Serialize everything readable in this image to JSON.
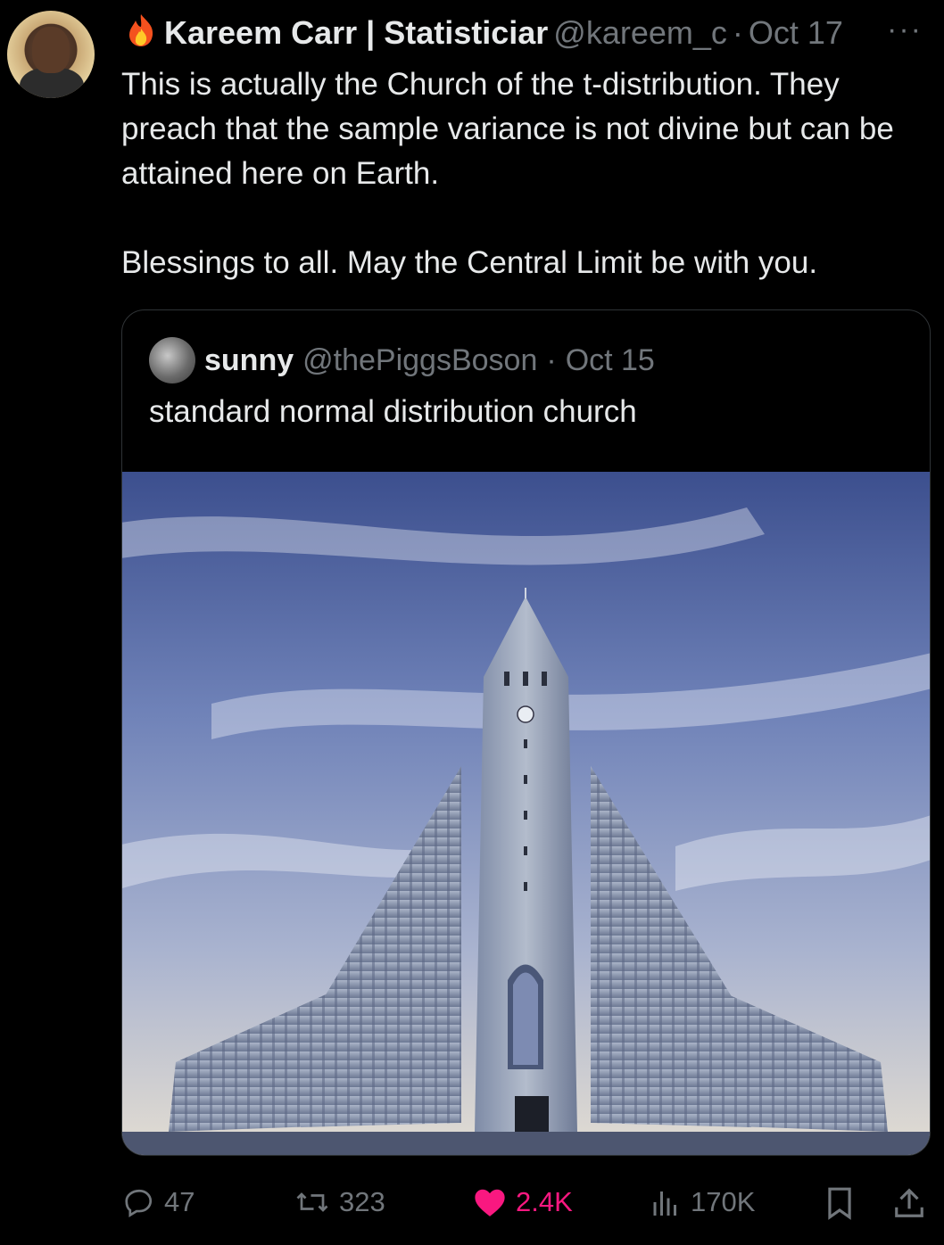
{
  "tweet": {
    "author_name": "Kareem Carr | Statisticiar",
    "handle": "@kareem_c",
    "separator": "·",
    "date": "Oct 17",
    "more": "···",
    "paragraph1": "This is actually the Church of the t-distribution. They preach that the sample variance is not divine but can be attained here on Earth.",
    "paragraph2": "Blessings to all. May the Central Limit be with you."
  },
  "quote": {
    "author_name": "sunny",
    "handle": "@thePiggsBoson",
    "separator": "·",
    "date": "Oct 15",
    "text": "standard normal distribution church"
  },
  "actions": {
    "replies": "47",
    "retweets": "323",
    "likes": "2.4K",
    "views": "170K"
  },
  "colors": {
    "background": "#000000",
    "text": "#e7e9ea",
    "muted": "#71767b",
    "like": "#f91880"
  },
  "icons": [
    "fire-icon",
    "more-icon",
    "reply-icon",
    "retweet-icon",
    "heart-icon",
    "views-icon",
    "bookmark-icon",
    "share-icon"
  ]
}
